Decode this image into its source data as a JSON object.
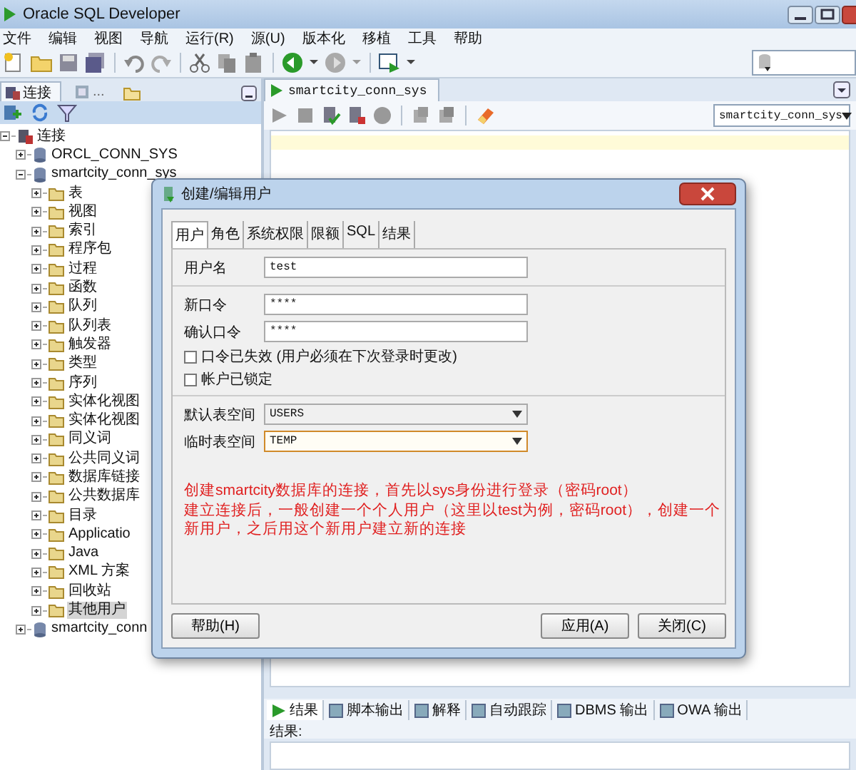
{
  "window": {
    "title": "Oracle SQL Developer"
  },
  "menu": [
    "文件",
    "编辑",
    "视图",
    "导航",
    "运行(R)",
    "源(U)",
    "版本化",
    "移植",
    "工具",
    "帮助"
  ],
  "left_panel": {
    "tabs": [
      {
        "label": "连接",
        "selected": true
      },
      {
        "label": "...",
        "selected": false
      }
    ]
  },
  "tree": [
    {
      "label": "连接",
      "expanded": true,
      "selected": false,
      "children": [
        {
          "label": "ORCL_CONN_SYS",
          "expanded": false,
          "selected": false
        },
        {
          "label": "smartcity_conn_sys",
          "expanded": true,
          "selected": false,
          "children": [
            {
              "label": "表",
              "expanded": false,
              "selected": false
            },
            {
              "label": "视图",
              "expanded": false,
              "selected": false
            },
            {
              "label": "索引",
              "expanded": false,
              "selected": false
            },
            {
              "label": "程序包",
              "expanded": false,
              "selected": false
            },
            {
              "label": "过程",
              "expanded": false,
              "selected": false
            },
            {
              "label": "函数",
              "expanded": false,
              "selected": false
            },
            {
              "label": "队列",
              "expanded": false,
              "selected": false
            },
            {
              "label": "队列表",
              "expanded": false,
              "selected": false
            },
            {
              "label": "触发器",
              "expanded": false,
              "selected": false
            },
            {
              "label": "类型",
              "expanded": false,
              "selected": false
            },
            {
              "label": "序列",
              "expanded": false,
              "selected": false
            },
            {
              "label": "实体化视图",
              "expanded": false,
              "selected": false
            },
            {
              "label": "实体化视图",
              "expanded": false,
              "selected": false
            },
            {
              "label": "同义词",
              "expanded": false,
              "selected": false
            },
            {
              "label": "公共同义词",
              "expanded": false,
              "selected": false
            },
            {
              "label": "数据库链接",
              "expanded": false,
              "selected": false
            },
            {
              "label": "公共数据库",
              "expanded": false,
              "selected": false
            },
            {
              "label": "目录",
              "expanded": false,
              "selected": false
            },
            {
              "label": "Applicatio",
              "expanded": false,
              "selected": false
            },
            {
              "label": "Java",
              "expanded": false,
              "selected": false
            },
            {
              "label": "XML 方案",
              "expanded": false,
              "selected": false
            },
            {
              "label": "回收站",
              "expanded": false,
              "selected": false
            },
            {
              "label": "其他用户",
              "expanded": false,
              "selected": true
            }
          ]
        },
        {
          "label": "smartcity_conn",
          "expanded": false,
          "selected": false
        }
      ]
    }
  ],
  "editor": {
    "tab": "smartcity_conn_sys",
    "connection": "smartcity_conn_sys"
  },
  "output": {
    "tabs": [
      {
        "label": "结果",
        "selected": true
      },
      {
        "label": "脚本输出",
        "selected": false
      },
      {
        "label": "解释",
        "selected": false
      },
      {
        "label": "自动跟踪",
        "selected": false
      },
      {
        "label": "DBMS 输出",
        "selected": false
      },
      {
        "label": "OWA 输出",
        "selected": false
      }
    ],
    "label": "结果:"
  },
  "dialog": {
    "title": "创建/编辑用户",
    "tabs": [
      {
        "label": "用户",
        "selected": true
      },
      {
        "label": "角色",
        "selected": false
      },
      {
        "label": "系统权限",
        "selected": false
      },
      {
        "label": "限额",
        "selected": false
      },
      {
        "label": "SQL",
        "selected": false
      },
      {
        "label": "结果",
        "selected": false
      }
    ],
    "username": {
      "label": "用户名",
      "value": "test"
    },
    "passwords": [
      {
        "label": "新口令",
        "value": "****"
      },
      {
        "label": "确认口令",
        "value": "****"
      }
    ],
    "checkboxes": [
      {
        "label": "口令已失效 (用户必须在下次登录时更改)",
        "checked": false
      },
      {
        "label": "帐户已锁定",
        "checked": false
      }
    ],
    "tablespaces": [
      {
        "label": "默认表空间",
        "value": "USERS",
        "focused": false
      },
      {
        "label": "临时表空间",
        "value": "TEMP",
        "focused": true
      }
    ],
    "annotation": [
      "创建smartcity数据库的连接，首先以sys身份进行登录（密码root）",
      "建立连接后，一般创建一个个人用户（这里以test为例，密码root），创建一个",
      "新用户，之后用这个新用户建立新的连接"
    ],
    "buttons": [
      {
        "label": "帮助(H)",
        "kind": "left"
      },
      {
        "label": "应用(A)",
        "kind": "right"
      },
      {
        "label": "关闭(C)",
        "kind": "right"
      }
    ]
  }
}
